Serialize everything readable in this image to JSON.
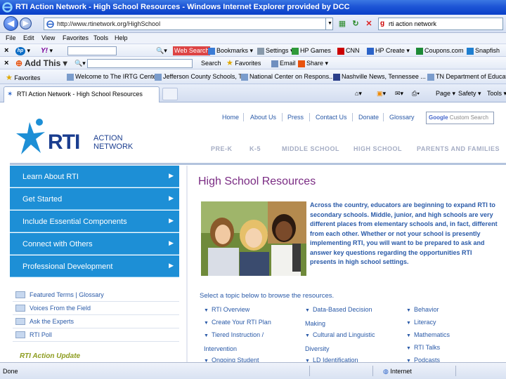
{
  "window": {
    "title": "RTI Action Network - High School Resources - Windows Internet Explorer provided by DCC"
  },
  "address_bar": {
    "url": "http://www.rtinetwork.org/HighSchool",
    "search_text": "rti action network"
  },
  "menu": [
    "File",
    "Edit",
    "View",
    "Favorites",
    "Tools",
    "Help"
  ],
  "toolbar_hp": {
    "items": [
      "Web Search",
      "Search",
      "Bookmarks",
      "Settings",
      "HP Games",
      "CNN",
      "HP Create",
      "Coupons.com",
      "Snapfish"
    ]
  },
  "toolbar_addthis": {
    "addthis_label": "Add This",
    "items": [
      "Search",
      "Favorites",
      "Email",
      "Share"
    ]
  },
  "favorites_bar": {
    "items": [
      "Favorites",
      "Welcome to The IRTG Center",
      "Jefferson County Schools, TN",
      "National Center on Respons...",
      "Nashville News, Tennessee ...",
      "TN Department of Educatio..."
    ]
  },
  "tab": {
    "label": "RTI Action Network - High School Resources",
    "commands": [
      "Page",
      "Safety",
      "Tools"
    ]
  },
  "site": {
    "logo_text": "RTI",
    "logo_action": "ACTION",
    "logo_network": "NETWORK",
    "top_links": [
      "Home",
      "About Us",
      "Press",
      "Contact Us",
      "Donate",
      "Glossary"
    ],
    "search_placeholder": "Custom Search",
    "level_tabs": [
      "PRE-K",
      "K-5",
      "MIDDLE SCHOOL",
      "HIGH SCHOOL",
      "PARENTS AND FAMILIES"
    ],
    "left_menu": [
      "Learn About RTI",
      "Get Started",
      "Include Essential Components",
      "Connect with Others",
      "Professional Development"
    ],
    "resource_links": [
      "Featured Terms | Glossary",
      "Voices From the Field",
      "Ask the Experts",
      "RTI Poll"
    ],
    "update_heading": "RTI Action Update",
    "page_heading": "High School Resources",
    "intro": "Across the country, educators are beginning to expand RTI to secondary schools. Middle, junior, and high schools are very different places from elementary schools and, in fact, different from each other. Whether or not your school is presently implementing RTI, you will want to be prepared to ask and answer key questions regarding the opportunities RTI presents in high school settings.",
    "topic_prompt": "Select a topic below to browse the resources.",
    "topics": {
      "col1": [
        "RTI Overview",
        "Create Your RTI Plan",
        "Tiered Instruction / Intervention",
        "Ongoing Student"
      ],
      "col2": [
        "Data-Based Decision Making",
        "Cultural and Linguistic Diversity",
        "LD Identification"
      ],
      "col3": [
        "Behavior",
        "Literacy",
        "Mathematics",
        "RTI Talks",
        "Podcasts"
      ]
    }
  },
  "status_bar": {
    "text": "Done",
    "zone": "Internet"
  },
  "colors": {
    "menu_blue": "#1d8fd6",
    "heading_purple": "#7a2b83",
    "link_blue": "#2a5aa8",
    "logo_navy": "#1a3d8f"
  }
}
